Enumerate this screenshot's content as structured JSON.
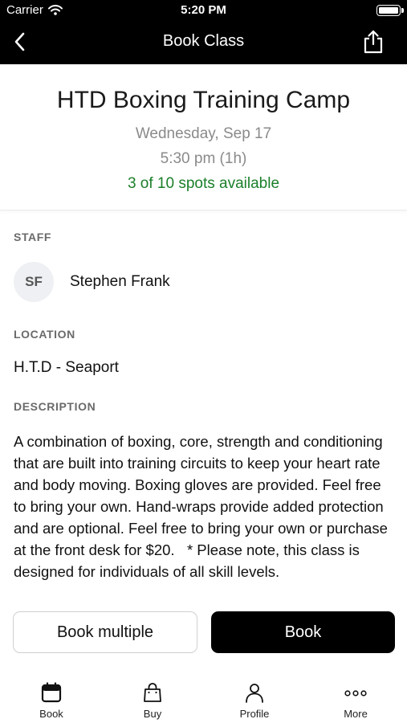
{
  "status_bar": {
    "carrier": "Carrier",
    "time": "5:20 PM"
  },
  "nav": {
    "title": "Book Class",
    "back_icon": "chevron-left-icon",
    "share_icon": "share-icon"
  },
  "class": {
    "title": "HTD Boxing Training Camp",
    "date": "Wednesday, Sep 17",
    "time": "5:30 pm (1h)",
    "spots": "3 of 10 spots available",
    "spots_color": "#1b7f2a"
  },
  "staff": {
    "label": "STAFF",
    "initials": "SF",
    "name": "Stephen Frank"
  },
  "location": {
    "label": "LOCATION",
    "value": "H.T.D - Seaport"
  },
  "description": {
    "label": "DESCRIPTION",
    "text": "A combination of boxing, core, strength and conditioning that are built into training circuits to keep your heart rate and body moving. Boxing gloves are provided. Feel free to bring your own. Hand-wraps provide added protection and are optional. Feel free to bring your own or purchase at the front desk for $20.   * Please note, this class is designed for individuals of all skill levels."
  },
  "actions": {
    "book_multiple": "Book multiple",
    "book": "Book"
  },
  "tabs": [
    {
      "label": "Book",
      "icon": "calendar-icon"
    },
    {
      "label": "Buy",
      "icon": "shopping-bag-icon"
    },
    {
      "label": "Profile",
      "icon": "person-icon"
    },
    {
      "label": "More",
      "icon": "more-dots-icon"
    }
  ]
}
